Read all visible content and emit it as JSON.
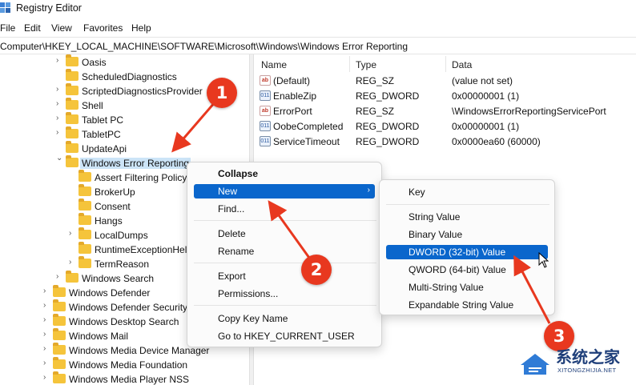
{
  "window": {
    "title": "Registry Editor"
  },
  "menu": [
    "File",
    "Edit",
    "View",
    "Favorites",
    "Help"
  ],
  "address": "Computer\\HKEY_LOCAL_MACHINE\\SOFTWARE\\Microsoft\\Windows\\Windows Error Reporting",
  "tree": [
    {
      "label": "Oasis",
      "chev": ">"
    },
    {
      "label": "ScheduledDiagnostics",
      "chev": ""
    },
    {
      "label": "ScriptedDiagnosticsProvider",
      "chev": ">"
    },
    {
      "label": "Shell",
      "chev": ">"
    },
    {
      "label": "Tablet PC",
      "chev": ">"
    },
    {
      "label": "TabletPC",
      "chev": ">"
    },
    {
      "label": "UpdateApi",
      "chev": ""
    },
    {
      "label": "Windows Error Reporting",
      "chev": "v",
      "selected": true
    },
    {
      "label": "Assert Filtering Policy",
      "chev": ""
    },
    {
      "label": "BrokerUp",
      "chev": ""
    },
    {
      "label": "Consent",
      "chev": ""
    },
    {
      "label": "Hangs",
      "chev": ""
    },
    {
      "label": "LocalDumps",
      "chev": ">"
    },
    {
      "label": "RuntimeExceptionHelperModules",
      "chev": ""
    },
    {
      "label": "TermReason",
      "chev": ">"
    },
    {
      "label": "Windows Search",
      "chev": ">"
    },
    {
      "label": "Windows Defender",
      "chev": ">"
    },
    {
      "label": "Windows Defender Security Center",
      "chev": ">"
    },
    {
      "label": "Windows Desktop Search",
      "chev": ">"
    },
    {
      "label": "Windows Mail",
      "chev": ">"
    },
    {
      "label": "Windows Media Device Manager",
      "chev": ">"
    },
    {
      "label": "Windows Media Foundation",
      "chev": ">"
    },
    {
      "label": "Windows Media Player NSS",
      "chev": ">"
    }
  ],
  "columns": {
    "name": "Name",
    "type": "Type",
    "data": "Data"
  },
  "values": [
    {
      "icon": "ab",
      "name": "(Default)",
      "type": "REG_SZ",
      "data": "(value not set)"
    },
    {
      "icon": "dw",
      "name": "EnableZip",
      "type": "REG_DWORD",
      "data": "0x00000001 (1)"
    },
    {
      "icon": "ab",
      "name": "ErrorPort",
      "type": "REG_SZ",
      "data": "\\WindowsErrorReportingServicePort"
    },
    {
      "icon": "dw",
      "name": "OobeCompleted",
      "type": "REG_DWORD",
      "data": "0x00000001 (1)"
    },
    {
      "icon": "dw",
      "name": "ServiceTimeout",
      "type": "REG_DWORD",
      "data": "0x0000ea60 (60000)"
    }
  ],
  "context_menu": {
    "collapse": "Collapse",
    "new": "New",
    "find": "Find...",
    "delete": "Delete",
    "rename": "Rename",
    "export": "Export",
    "permissions": "Permissions...",
    "copy_key_name": "Copy Key Name",
    "goto_hkcu": "Go to HKEY_CURRENT_USER"
  },
  "submenu": {
    "key": "Key",
    "string": "String Value",
    "binary": "Binary Value",
    "dword": "DWORD (32-bit) Value",
    "qword": "QWORD (64-bit) Value",
    "multi_string": "Multi-String Value",
    "expandable_string": "Expandable String Value"
  },
  "annotations": {
    "step1": "1",
    "step2": "2",
    "step3": "3"
  },
  "watermark": {
    "title": "系统之家",
    "url": "XITONGZHIJIA.NET"
  },
  "colors": {
    "highlight": "#0a66cc",
    "badge": "#e8381f",
    "folder": "#f5c43b"
  }
}
